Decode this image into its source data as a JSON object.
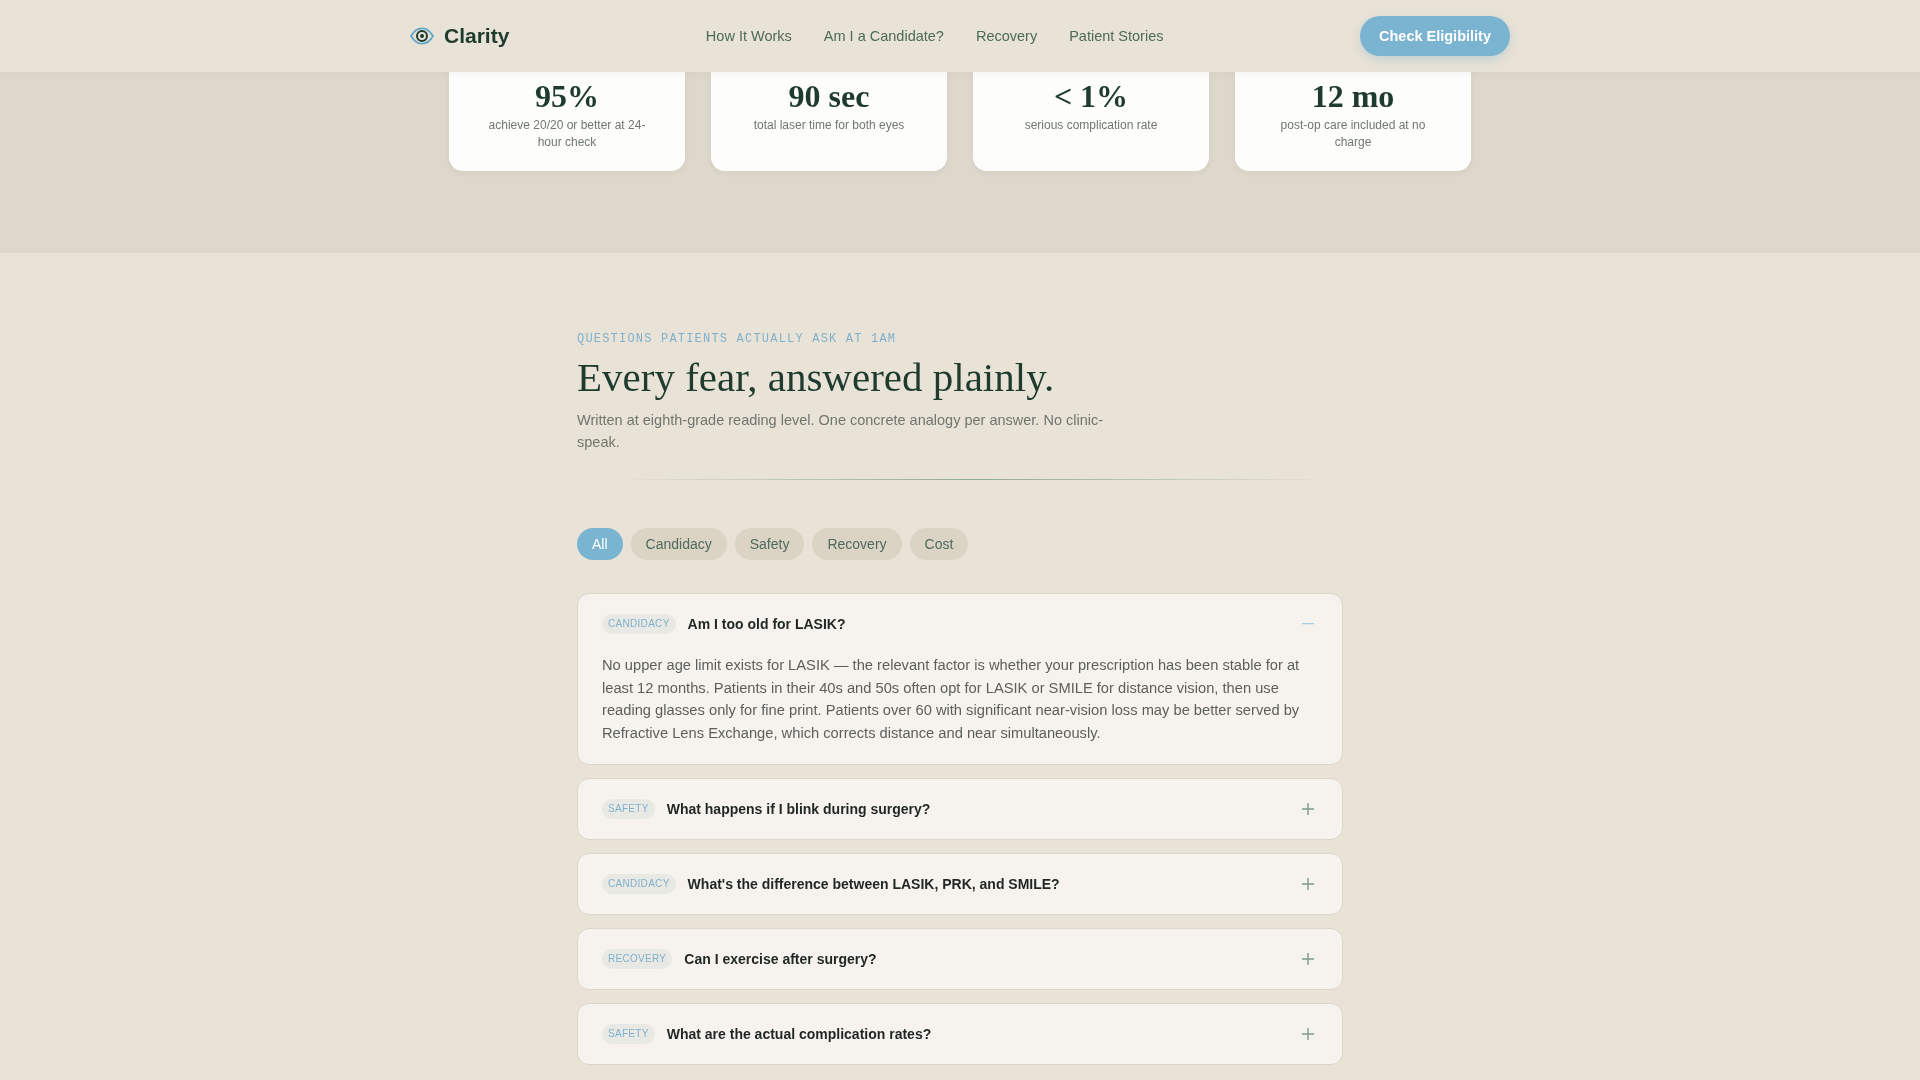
{
  "header": {
    "brand": "Clarity",
    "nav": [
      "How It Works",
      "Am I a Candidate?",
      "Recovery",
      "Patient Stories"
    ],
    "cta": "Check Eligibility"
  },
  "stats": [
    {
      "value": "95%",
      "label": "achieve 20/20 or better at 24-hour check"
    },
    {
      "value": "90 sec",
      "label": "total laser time for both eyes"
    },
    {
      "value": "< 1%",
      "label": "serious complication rate"
    },
    {
      "value": "12 mo",
      "label": "post-op care included at no charge"
    }
  ],
  "faq": {
    "eyebrow": "QUESTIONS PATIENTS ACTUALLY ASK AT 1AM",
    "title": "Every fear, answered plainly.",
    "subtitle": "Written at eighth-grade reading level. One concrete analogy per answer. No clinic-speak.",
    "filters": [
      {
        "label": "All",
        "selected": true
      },
      {
        "label": "Candidacy",
        "selected": false
      },
      {
        "label": "Safety",
        "selected": false
      },
      {
        "label": "Recovery",
        "selected": false
      },
      {
        "label": "Cost",
        "selected": false
      }
    ],
    "items": [
      {
        "tag": "CANDIDACY",
        "question": "Am I too old for LASIK?",
        "expanded": true,
        "answer": "No upper age limit exists for LASIK — the relevant factor is whether your prescription has been stable for at least 12 months. Patients in their 40s and 50s often opt for LASIK or SMILE for distance vision, then use reading glasses only for fine print. Patients over 60 with significant near-vision loss may be better served by Refractive Lens Exchange, which corrects distance and near simultaneously."
      },
      {
        "tag": "SAFETY",
        "question": "What happens if I blink during surgery?",
        "expanded": false
      },
      {
        "tag": "CANDIDACY",
        "question": "What's the difference between LASIK, PRK, and SMILE?",
        "expanded": false
      },
      {
        "tag": "RECOVERY",
        "question": "Can I exercise after surgery?",
        "expanded": false
      },
      {
        "tag": "SAFETY",
        "question": "What are the actual complication rates?",
        "expanded": false
      }
    ]
  }
}
